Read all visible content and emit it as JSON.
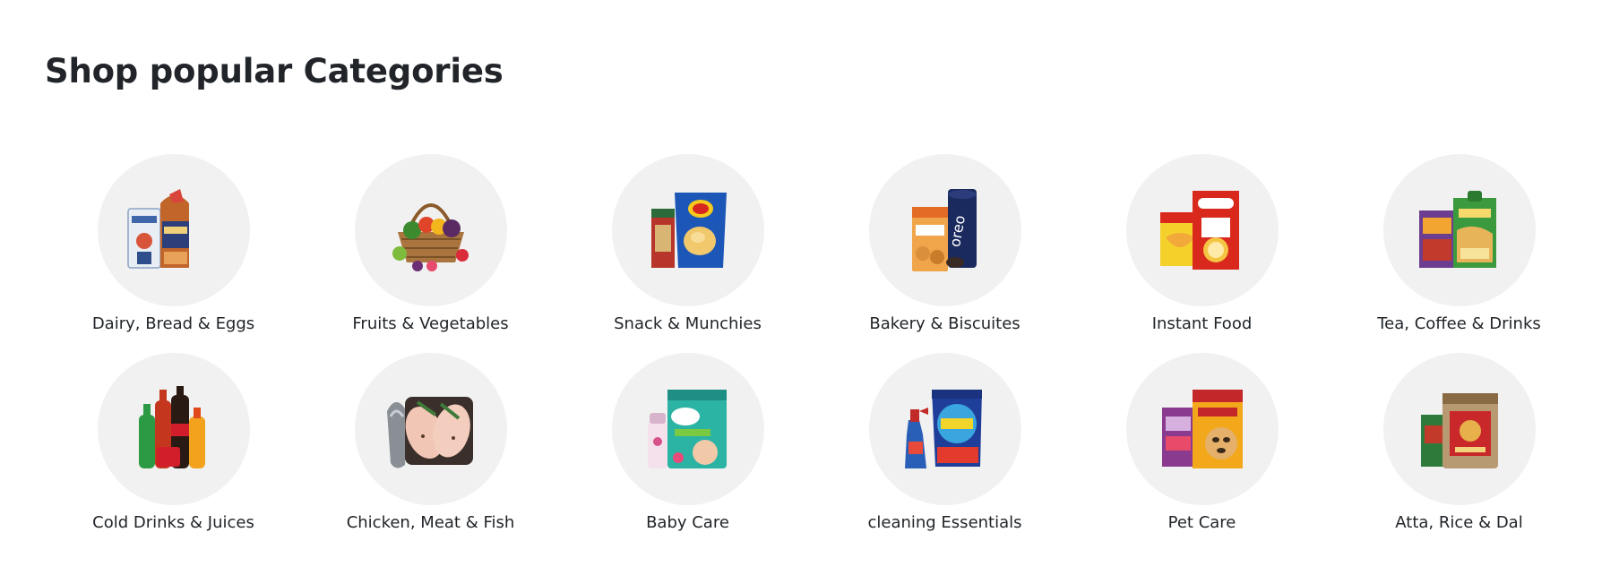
{
  "section": {
    "title": "Shop popular Categories"
  },
  "categories": [
    {
      "label": "Dairy, Bread & Eggs",
      "icon": "bread-milk-icon"
    },
    {
      "label": "Fruits & Vegetables",
      "icon": "vegetable-basket-icon"
    },
    {
      "label": "Snack & Munchies",
      "icon": "chips-packet-icon"
    },
    {
      "label": "Bakery & Biscuites",
      "icon": "biscuit-pack-icon"
    },
    {
      "label": "Instant Food",
      "icon": "noodles-cereal-icon"
    },
    {
      "label": "Tea, Coffee & Drinks",
      "icon": "tea-pack-icon"
    },
    {
      "label": "Cold Drinks & Juices",
      "icon": "soda-bottles-icon"
    },
    {
      "label": "Chicken, Meat & Fish",
      "icon": "chicken-fish-icon"
    },
    {
      "label": "Baby Care",
      "icon": "diaper-pack-icon"
    },
    {
      "label": "cleaning Essentials",
      "icon": "detergent-icon"
    },
    {
      "label": "Pet Care",
      "icon": "pet-food-icon"
    },
    {
      "label": "Atta, Rice & Dal",
      "icon": "rice-bag-icon"
    }
  ],
  "colors": {
    "circle_bg": "#f0f1f0",
    "text": "#212529"
  }
}
